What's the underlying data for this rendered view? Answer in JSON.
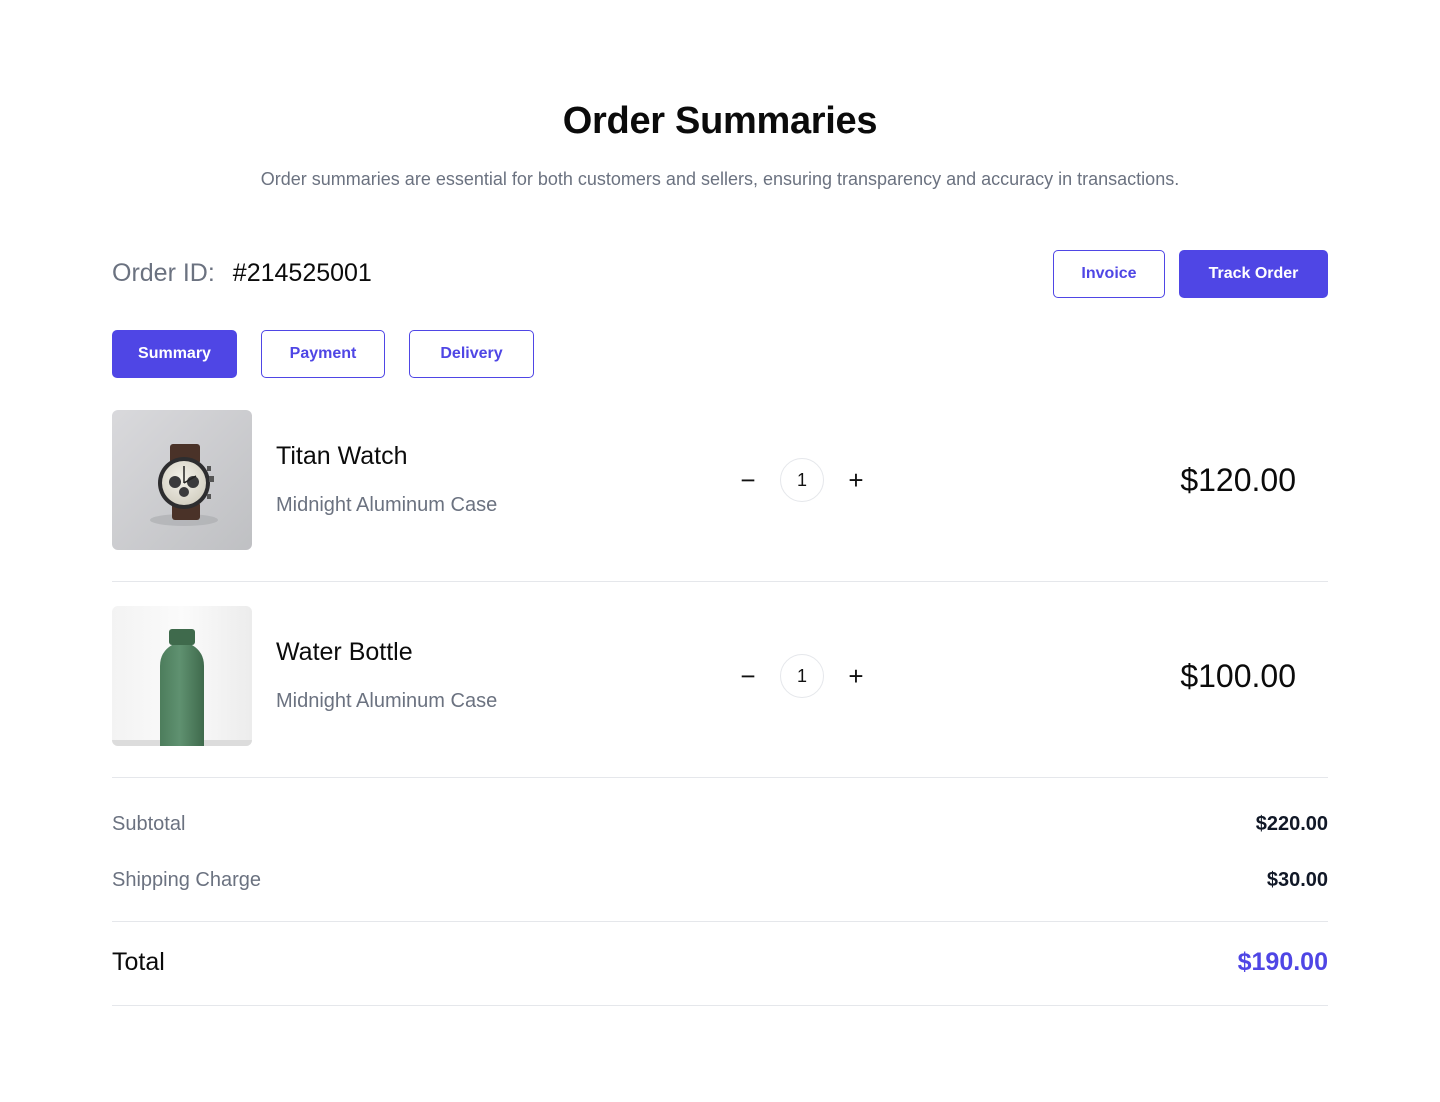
{
  "header": {
    "title": "Order Summaries",
    "subtitle": "Order summaries are essential for both customers and sellers, ensuring transparency and accuracy in transactions."
  },
  "order": {
    "id_label": "Order ID:",
    "id_value": "#214525001"
  },
  "actions": {
    "invoice_label": "Invoice",
    "track_label": "Track Order"
  },
  "tabs": [
    {
      "label": "Summary",
      "active": true
    },
    {
      "label": "Payment",
      "active": false
    },
    {
      "label": "Delivery",
      "active": false
    }
  ],
  "items": [
    {
      "name": "Titan Watch",
      "variant": "Midnight Aluminum Case",
      "quantity": "1",
      "price": "$120.00",
      "image": "watch-image"
    },
    {
      "name": "Water Bottle",
      "variant": "Midnight Aluminum Case",
      "quantity": "1",
      "price": "$100.00",
      "image": "bottle-image"
    }
  ],
  "summary": {
    "subtotal_label": "Subtotal",
    "subtotal_value": "$220.00",
    "shipping_label": "Shipping Charge",
    "shipping_value": "$30.00",
    "total_label": "Total",
    "total_value": "$190.00"
  },
  "colors": {
    "accent": "#4f46e5",
    "muted_text": "#6b7280",
    "divider": "#e5e7eb"
  }
}
